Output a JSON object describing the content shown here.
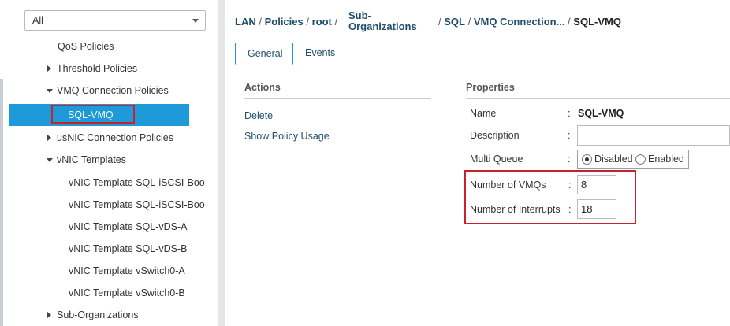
{
  "sidebar": {
    "filter": {
      "value": "All"
    },
    "tree": [
      {
        "label": "QoS Policies",
        "expander": "none"
      },
      {
        "label": "Threshold Policies",
        "expander": "collapsed"
      },
      {
        "label": "VMQ Connection Policies",
        "expander": "expanded"
      },
      {
        "label": "SQL-VMQ",
        "expander": "none",
        "selected": true
      },
      {
        "label": "usNIC Connection Policies",
        "expander": "collapsed"
      },
      {
        "label": "vNIC Templates",
        "expander": "expanded"
      },
      {
        "label": "vNIC Template SQL-iSCSI-Boo",
        "expander": "none"
      },
      {
        "label": "vNIC Template SQL-iSCSI-Boo",
        "expander": "none"
      },
      {
        "label": "vNIC Template SQL-vDS-A",
        "expander": "none"
      },
      {
        "label": "vNIC Template SQL-vDS-B",
        "expander": "none"
      },
      {
        "label": "vNIC Template vSwitch0-A",
        "expander": "none"
      },
      {
        "label": "vNIC Template vSwitch0-B",
        "expander": "none"
      },
      {
        "label": "Sub-Organizations",
        "expander": "collapsed"
      }
    ]
  },
  "breadcrumb": {
    "lan": "LAN",
    "policies": "Policies",
    "root": "root",
    "suborg_line1": "Sub-",
    "suborg_line2": "Organizations",
    "sql": "SQL",
    "vmq": "VMQ Connection...",
    "current": "SQL-VMQ",
    "separator": "/"
  },
  "tabs": {
    "general": "General",
    "events": "Events"
  },
  "actions": {
    "title": "Actions",
    "delete": "Delete",
    "show_usage": "Show Policy Usage"
  },
  "properties": {
    "title": "Properties",
    "colon": ":",
    "name_label": "Name",
    "name_value": "SQL-VMQ",
    "description_label": "Description",
    "description_value": "",
    "multi_queue_label": "Multi Queue",
    "disabled": "Disabled",
    "enabled": "Enabled",
    "multi_queue_selected": "Disabled",
    "vmqs_label": "Number of VMQs",
    "vmqs_value": "8",
    "interrupts_label": "Number of Interrupts",
    "interrupts_value": "18"
  },
  "colors": {
    "accent": "#1d9ad7",
    "highlight": "#c9222e",
    "link": "#1f4e6d"
  }
}
